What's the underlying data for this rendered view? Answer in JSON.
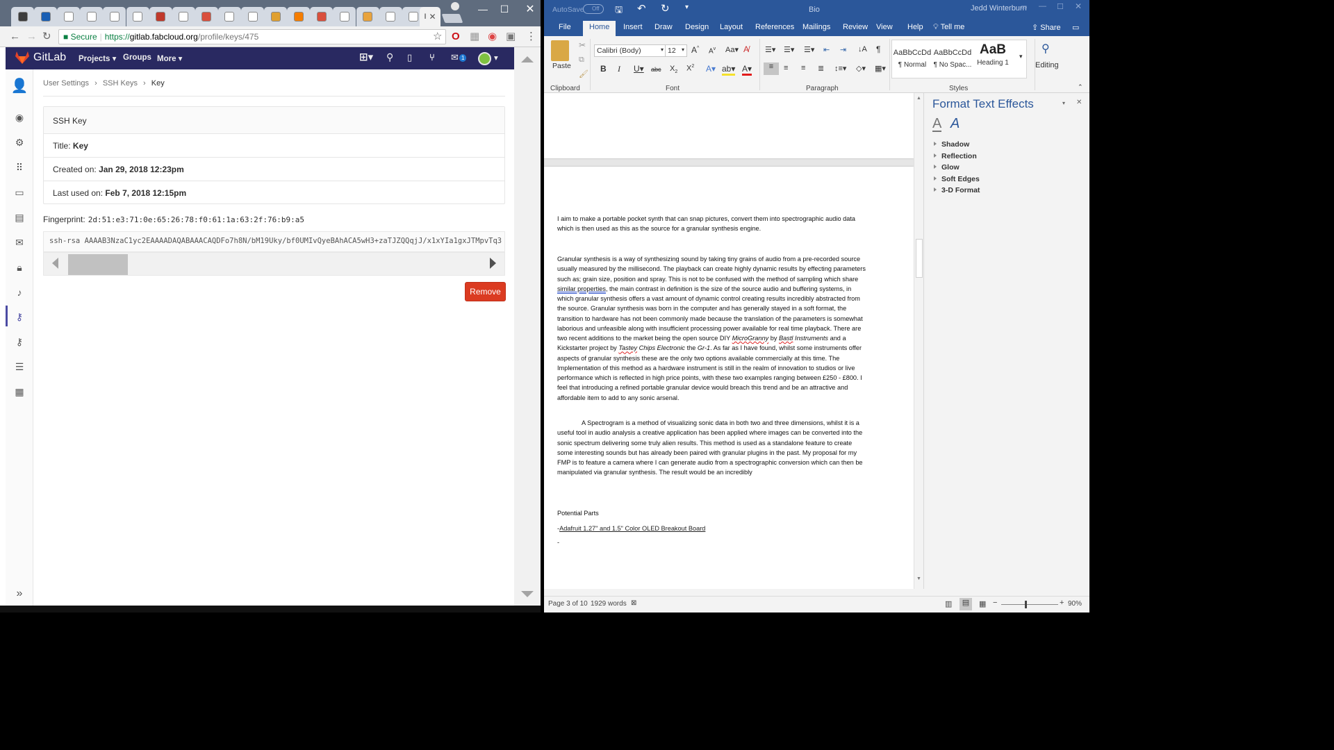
{
  "chrome": {
    "tabs": [
      {
        "icon": "bb-icon",
        "color": "#3d3d3d"
      },
      {
        "icon": "shield-icon",
        "color": "#1a5fb4"
      },
      {
        "icon": "doc-icon",
        "color": "#ffffff"
      },
      {
        "icon": "google-icon",
        "color": "#ffffff"
      },
      {
        "icon": "doc-icon",
        "color": "#ffffff"
      },
      {
        "icon": "google-icon",
        "color": "#ffffff"
      },
      {
        "icon": "cloud-red-icon",
        "color": "#c0392b"
      },
      {
        "icon": "doc-icon",
        "color": "#ffffff"
      },
      {
        "icon": "multi-color-icon",
        "color": "#d94f3d"
      },
      {
        "icon": "doc-icon",
        "color": "#ffffff"
      },
      {
        "icon": "google-icon",
        "color": "#ffffff"
      },
      {
        "icon": "people-icon",
        "color": "#e0a030"
      },
      {
        "icon": "blogger-icon",
        "color": "#f57d00"
      },
      {
        "icon": "multi-color-icon",
        "color": "#d94f3d"
      },
      {
        "icon": "doc-icon",
        "color": "#ffffff"
      },
      {
        "icon": "hand-icon",
        "color": "#e8a33d"
      },
      {
        "icon": "doc-icon",
        "color": "#ffffff"
      },
      {
        "icon": "google-icon",
        "color": "#ffffff"
      }
    ],
    "active_tab_label": "I",
    "address": {
      "secure_label": "Secure",
      "scheme": "https://",
      "host": "gitlab.fabcloud.org",
      "path": "/profile/keys/475"
    }
  },
  "gitlab": {
    "brand": "GitLab",
    "menu": [
      "Projects",
      "Groups",
      "More"
    ],
    "notification_count": "1",
    "breadcrumb": [
      "User Settings",
      "SSH Keys",
      "Key"
    ],
    "card_title": "SSH Key",
    "title_label": "Title:",
    "title_value": "Key",
    "created_label": "Created on:",
    "created_value": "Jan 29, 2018 12:23pm",
    "used_label": "Last used on:",
    "used_value": "Feb 7, 2018 12:15pm",
    "fingerprint_label": "Fingerprint:",
    "fingerprint_value": "2d:51:e3:71:0e:65:26:78:f0:61:1a:63:2f:76:b9:a5",
    "key_text": "ssh-rsa AAAAB3NzaC1yc2EAAAADAQABAAACAQDFo7h8N/bM19Uky/bf0UMIvQyeBAhACA5wH3+zaTJZQQqjJ/x1xYIa1gxJTMpvTq3",
    "remove_label": "Remove",
    "accent": "#292961",
    "danger": "#db3b21"
  },
  "word": {
    "autosave_label": "AutoSave",
    "autosave_state": "Off",
    "doc_title": "Bio",
    "user_name": "Jedd Winterburn",
    "tabs": [
      "File",
      "Home",
      "Insert",
      "Draw",
      "Design",
      "Layout",
      "References",
      "Mailings",
      "Review",
      "View",
      "Help"
    ],
    "tell_me": "Tell me",
    "share": "Share",
    "paste_label": "Paste",
    "font_name": "Calibri (Body)",
    "font_size": "12",
    "styles": [
      {
        "sample": "AaBbCcDd",
        "name": "¶ Normal"
      },
      {
        "sample": "AaBbCcDd",
        "name": "¶ No Spac..."
      },
      {
        "sample": "AaB",
        "name": "Heading 1"
      }
    ],
    "editing_label": "Editing",
    "groups": [
      "Clipboard",
      "Font",
      "Paragraph",
      "Styles"
    ],
    "pane": {
      "title": "Format Text Effects",
      "items": [
        "Shadow",
        "Reflection",
        "Glow",
        "Soft Edges",
        "3-D Format"
      ]
    },
    "doc": {
      "p1": "I aim to make a portable pocket synth that can snap pictures, convert them into spectrographic audio data which is then used as this as the source for a granular synthesis engine.",
      "p2_a": "Granular synthesis is a way of synthesizing sound by taking tiny grains of audio from a pre-recorded source usually measured by the millisecond. The playback can create highly dynamic results by effecting parameters such as; grain size, position and spray. This is not to be confused with the method of sampling which share ",
      "p2_sq1": "similar properties",
      "p2_b": ", the main contrast in definition is the size of the source audio and buffering systems, in which granular synthesis offers a vast amount of dynamic control creating results incredibly abstracted from the source. Granular synthesis was born in the computer and has generally stayed in a soft format, the transition to hardware has not been commonly made because the translation of the parameters is somewhat laborious and unfeasible along with insufficient processing power available for real time playback. There are two recent additions to the market being the open source DIY ",
      "p2_i1": "MicroGranny",
      "p2_c": " by ",
      "p2_i2": "Bastl",
      "p2_i2b": " Instruments",
      "p2_d": " and a Kickstarter project by ",
      "p2_i3": "Tastey",
      "p2_i3b": " Chips Electronic",
      "p2_e": " the ",
      "p2_i4": "Gr-1",
      "p2_f": ". As far as I have found, whilst some instruments offer aspects of granular synthesis these are the only two options available commercially at this time. The Implementation of this method as a hardware instrument is still in the realm of innovation to studios or live performance which is reflected in high price points, with these two examples ranging between £250 - £800. I feel that introducing a refined portable granular device would breach this trend and be an attractive and affordable item to add to any sonic arsenal.",
      "p3": "A Spectrogram is a method of visualizing sonic data in both two and three dimensions, whilst it is a useful tool in audio analysis a creative application has been applied where images can be converted into the sonic spectrum delivering some truly alien results. This method is used as a standalone feature to create some interesting sounds but has already been paired with granular plugins in the past. My proposal for my FMP is to feature a camera where I can generate audio from a spectrographic conversion which can then be manipulated via granular synthesis. The result would be an incredibly",
      "heading": "Potential Parts",
      "part_prefix": "-",
      "part1": "Adafruit 1.27\" and 1.5\" Color OLED Breakout Board",
      "part2": "-"
    },
    "status": {
      "page": "Page 3 of 10",
      "words": "1929 words",
      "zoom": "90%"
    },
    "accent": "#2b579a"
  }
}
